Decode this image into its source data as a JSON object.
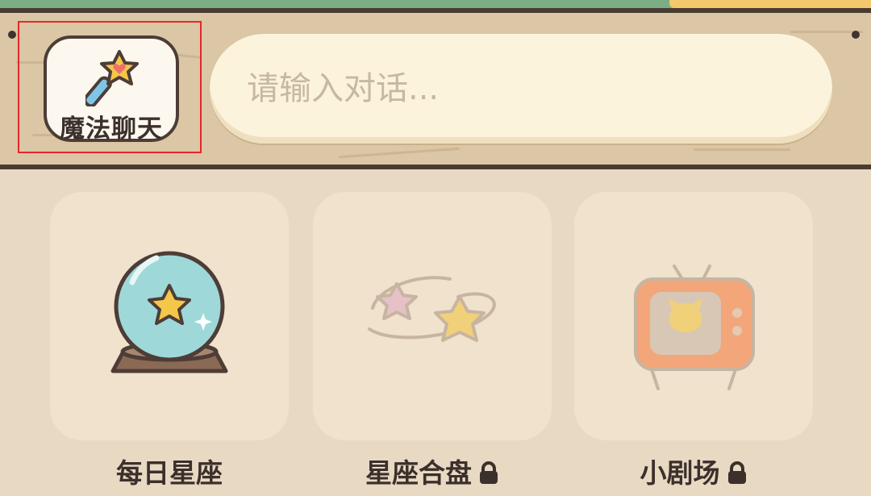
{
  "toolbar": {
    "magic_chat_label": "魔法聊天",
    "input_placeholder": "请输入对话..."
  },
  "cards": [
    {
      "label": "每日星座",
      "icon": "crystal-ball-icon",
      "locked": false
    },
    {
      "label": "星座合盘",
      "icon": "twin-stars-icon",
      "locked": true
    },
    {
      "label": "小剧场",
      "icon": "tv-icon",
      "locked": true
    }
  ],
  "colors": {
    "background": "#e8d9c3",
    "board": "#dbc6a6",
    "card": "#f0e2cd",
    "input": "#fcf3dc",
    "highlight_box": "#e62828",
    "text": "#3b302b"
  }
}
